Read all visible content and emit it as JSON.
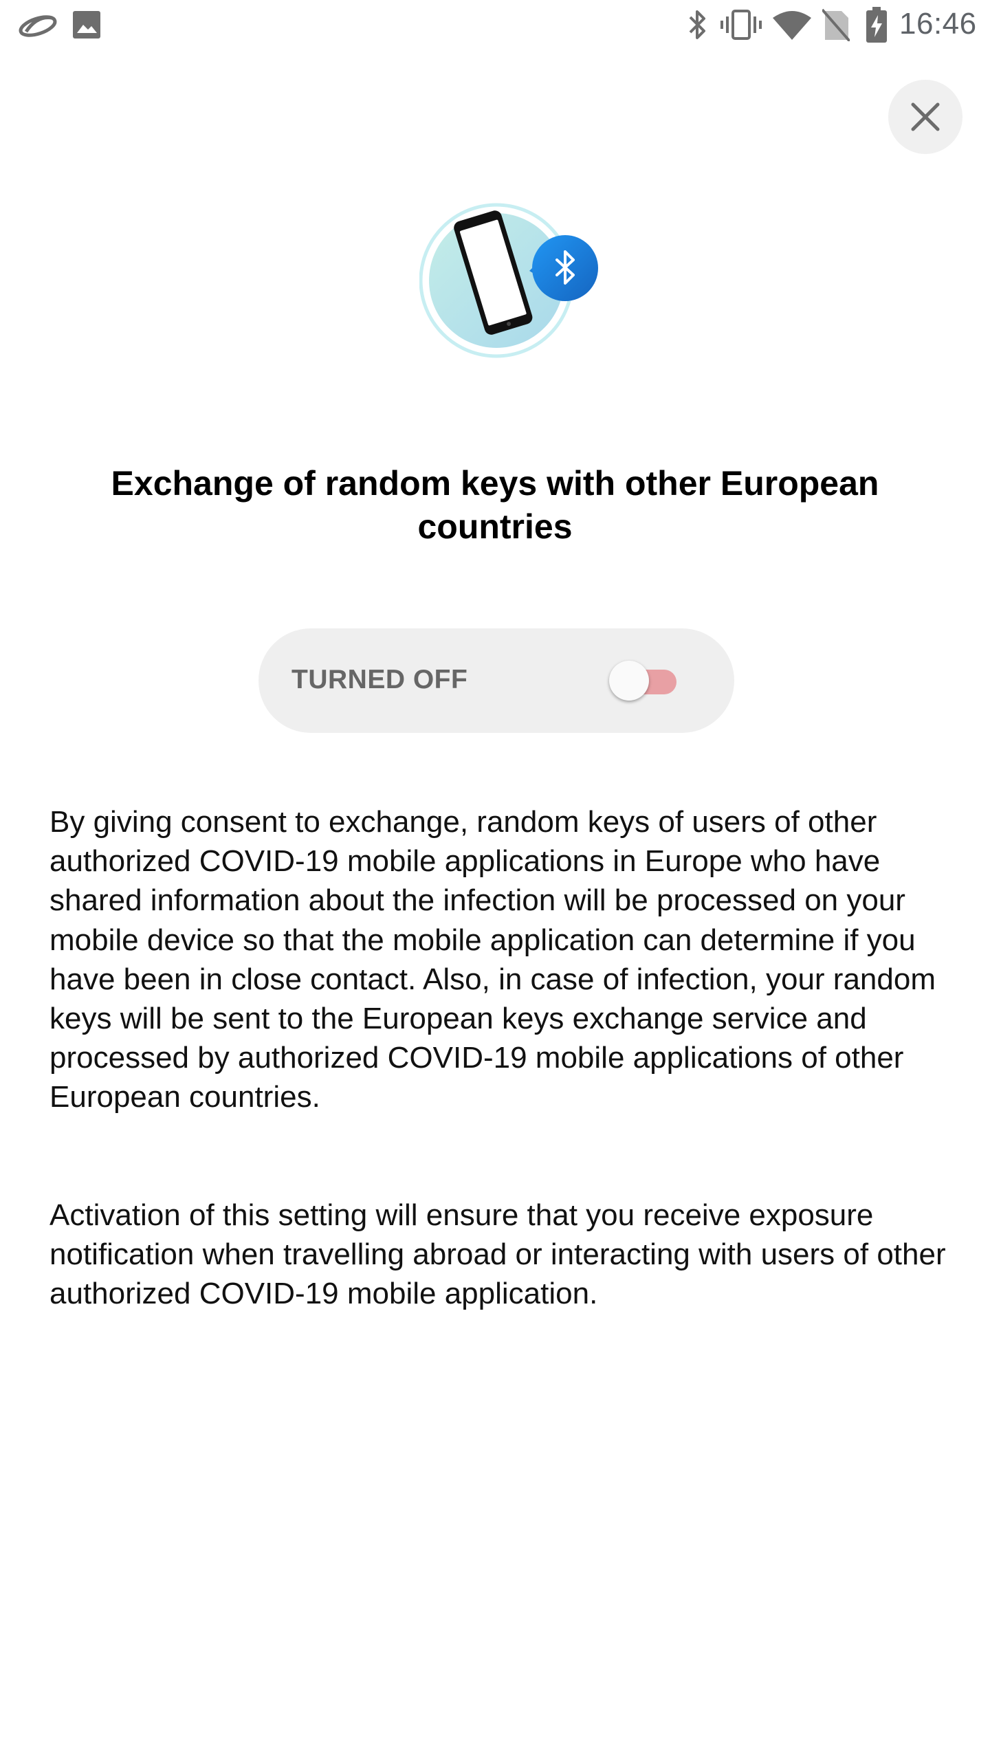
{
  "status_bar": {
    "left_icons": [
      "app-notification-icon",
      "image-icon"
    ],
    "right_icons": [
      "bluetooth-icon",
      "vibrate-icon",
      "wifi-icon",
      "no-sim-icon",
      "battery-charging-icon"
    ],
    "time": "16:46"
  },
  "close_button": {
    "icon": "close-icon"
  },
  "hero": {
    "icon": "phone-bluetooth-icon",
    "colors": {
      "circle": "#b6e3ea",
      "ring": "#c7eef2",
      "bluetooth_badge": "#1976d2"
    }
  },
  "title": "Exchange of random keys with other European countries",
  "toggle": {
    "label": "TURNED OFF",
    "state": "off",
    "colors": {
      "card": "#efefef",
      "track": "#e8a0a4",
      "thumb": "#fafafa"
    }
  },
  "body": {
    "paragraph_1": "By giving consent to exchange, random keys of users of other authorized COVID-19 mobile applications in Europe who have shared information about the infection will be processed on your mobile device so that the mobile application can determine if you have been in close contact. Also, in case of infection, your random keys will be sent to the European keys exchange service and processed by authorized COVID-19 mobile applications of other European countries.",
    "paragraph_2": "Activation of this setting will ensure that you receive exposure notification when travelling abroad or interacting with users of other authorized COVID-19 mobile application."
  }
}
